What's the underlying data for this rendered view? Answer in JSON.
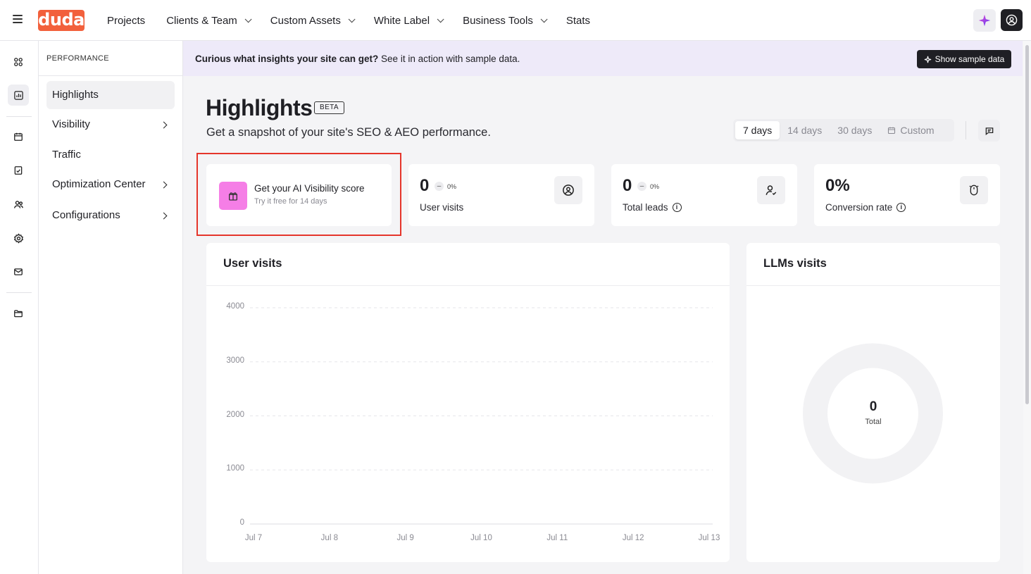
{
  "topbar": {
    "logo": "duda",
    "nav": [
      {
        "label": "Projects",
        "dropdown": false
      },
      {
        "label": "Clients & Team",
        "dropdown": true
      },
      {
        "label": "Custom Assets",
        "dropdown": true
      },
      {
        "label": "White Label",
        "dropdown": true
      },
      {
        "label": "Business Tools",
        "dropdown": true
      },
      {
        "label": "Stats",
        "dropdown": false
      }
    ]
  },
  "rail": {
    "icons": [
      "apps-icon",
      "analytics-icon",
      "calendar-icon",
      "checklist-icon",
      "users-icon",
      "settings-icon",
      "mail-icon",
      "folder-icon"
    ],
    "active": "analytics-icon"
  },
  "sidebar": {
    "heading": "PERFORMANCE",
    "items": [
      {
        "label": "Highlights",
        "expandable": false,
        "active": true
      },
      {
        "label": "Visibility",
        "expandable": true,
        "active": false
      },
      {
        "label": "Traffic",
        "expandable": false,
        "active": false
      },
      {
        "label": "Optimization Center",
        "expandable": true,
        "active": false
      },
      {
        "label": "Configurations",
        "expandable": true,
        "active": false
      }
    ]
  },
  "banner": {
    "bold": "Curious what insights your site can get?",
    "rest": " See it in action with sample data.",
    "button": "Show sample data"
  },
  "header": {
    "title": "Highlights",
    "badge": "BETA",
    "subtitle": "Get a snapshot of your site's SEO & AEO performance."
  },
  "range": {
    "options": [
      "7 days",
      "14 days",
      "30 days",
      "Custom"
    ],
    "selected": "7 days"
  },
  "promo": {
    "title": "Get your AI Visibility score",
    "subtitle": "Try it free for 14 days"
  },
  "metrics": [
    {
      "value": "0",
      "trend": "0%",
      "label": "User visits",
      "info": false,
      "icon": "user-circle-icon"
    },
    {
      "value": "0",
      "trend": "0%",
      "label": "Total leads",
      "info": true,
      "icon": "user-check-icon"
    },
    {
      "value": "0%",
      "trend": "",
      "label": "Conversion rate",
      "info": true,
      "icon": "mouse-icon"
    }
  ],
  "visits_panel": {
    "title": "User visits"
  },
  "llm_panel": {
    "title": "LLMs visits",
    "total_value": "0",
    "total_label": "Total"
  },
  "colors": {
    "brand": "#f2603c",
    "promo": "#f57ee6",
    "banner": "#eeeaf9",
    "highlight": "#e5352b"
  },
  "chart_data": {
    "type": "line",
    "title": "User visits",
    "x": [
      "Jul 7",
      "Jul 8",
      "Jul 9",
      "Jul 10",
      "Jul 11",
      "Jul 12",
      "Jul 13"
    ],
    "y_ticks": [
      "4000",
      "3000",
      "2000",
      "1000",
      "0"
    ],
    "ylim": [
      0,
      4000
    ],
    "series": [
      {
        "values": [
          0,
          0,
          0,
          0,
          0,
          0,
          0
        ]
      }
    ],
    "grid": true
  }
}
